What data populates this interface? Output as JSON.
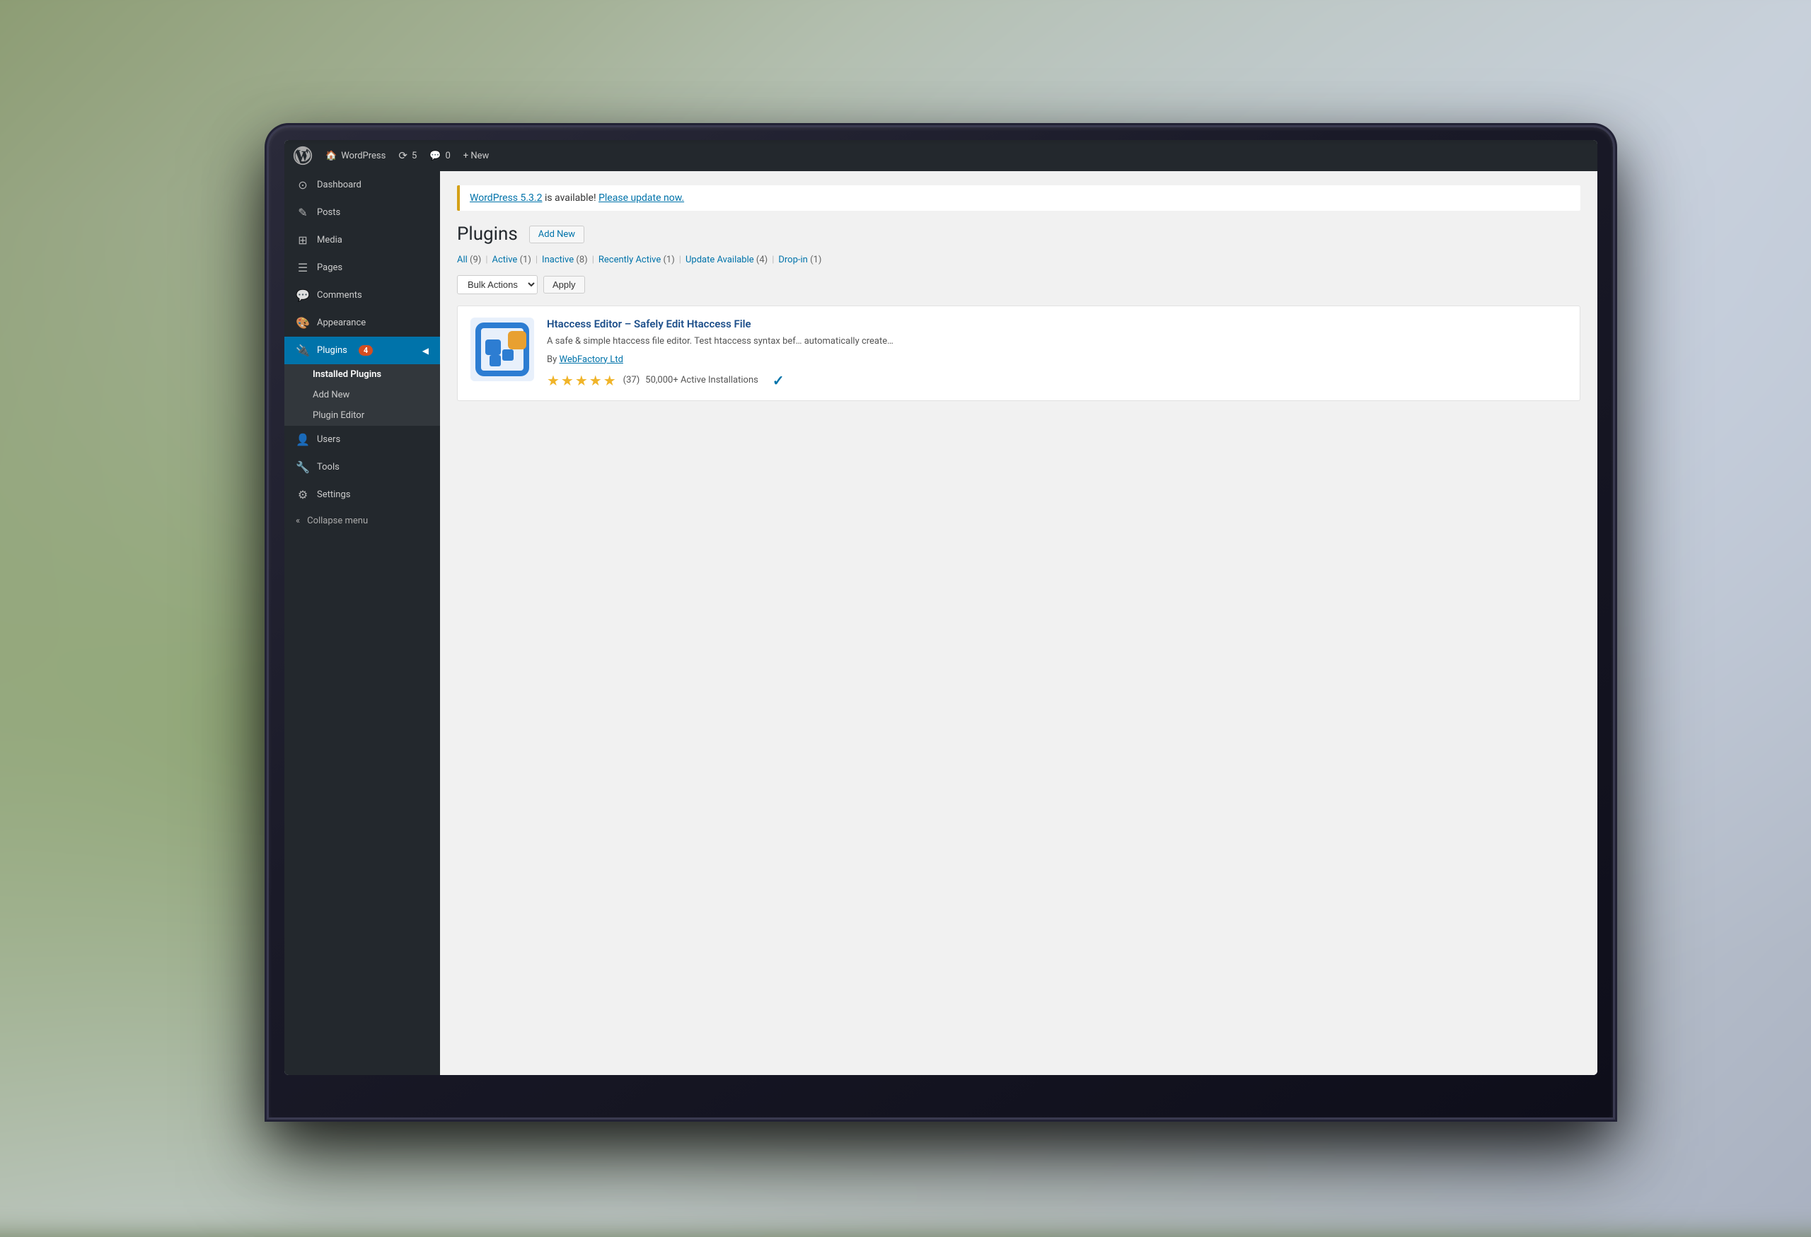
{
  "background": {
    "description": "Blurred outdoor background with green plant and light bokeh"
  },
  "admin_bar": {
    "wp_logo_label": "WordPress",
    "site_name": "WordPress",
    "update_count": "5",
    "comments_count": "0",
    "new_label": "+ New"
  },
  "sidebar": {
    "items": [
      {
        "id": "dashboard",
        "label": "Dashboard",
        "icon": "⊙"
      },
      {
        "id": "posts",
        "label": "Posts",
        "icon": "✎"
      },
      {
        "id": "media",
        "label": "Media",
        "icon": "⊞"
      },
      {
        "id": "pages",
        "label": "Pages",
        "icon": "☰"
      },
      {
        "id": "comments",
        "label": "Comments",
        "icon": "💬"
      },
      {
        "id": "appearance",
        "label": "Appearance",
        "icon": "🎨"
      },
      {
        "id": "plugins",
        "label": "Plugins",
        "icon": "🔌",
        "badge": "4",
        "active": true
      },
      {
        "id": "users",
        "label": "Users",
        "icon": "👤"
      },
      {
        "id": "tools",
        "label": "Tools",
        "icon": "🔧"
      },
      {
        "id": "settings",
        "label": "Settings",
        "icon": "⚙"
      }
    ],
    "plugins_submenu": [
      {
        "id": "installed-plugins",
        "label": "Installed Plugins",
        "active": true
      },
      {
        "id": "add-new",
        "label": "Add New"
      },
      {
        "id": "plugin-editor",
        "label": "Plugin Editor"
      }
    ],
    "collapse_label": "Collapse menu"
  },
  "update_notice": {
    "version_text": "WordPress 5.3.2",
    "message": " is available! ",
    "link_text": "Please update now."
  },
  "page": {
    "title": "Plugins",
    "add_new_label": "Add New"
  },
  "filter_bar": {
    "items": [
      {
        "label": "All",
        "count": "9"
      },
      {
        "label": "Active",
        "count": "1"
      },
      {
        "label": "Inactive",
        "count": "8"
      },
      {
        "label": "Recently Active",
        "count": "1"
      },
      {
        "label": "Update Available",
        "count": "4"
      },
      {
        "label": "Drop-in",
        "count": "1"
      }
    ]
  },
  "bulk_actions": {
    "label": "Bulk Actions",
    "dropdown_arrow": "▼",
    "apply_label": "Apply"
  },
  "plugins": [
    {
      "name": "Htaccess Editor – Safely Edit Htaccess File",
      "description": "A safe & simple htaccess file editor. Test htaccess syntax bef… automatically create…",
      "author": "By",
      "author_name": "WebFactory Ltd",
      "rating": 5,
      "review_count": "37",
      "installs": "50,000+ Active Installations",
      "active": true
    }
  ]
}
